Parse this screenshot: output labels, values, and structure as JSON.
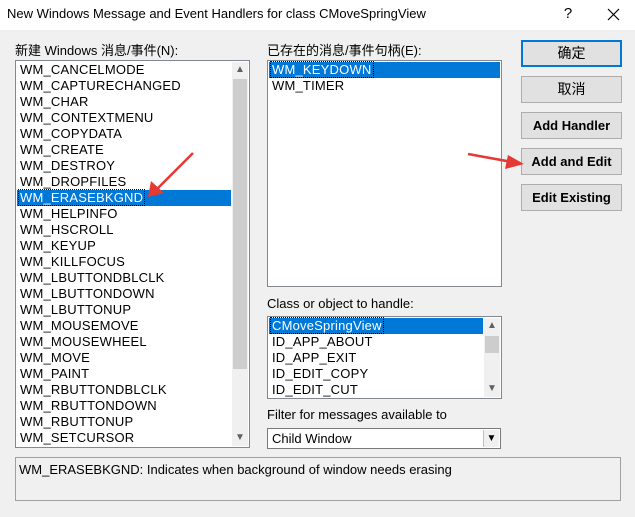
{
  "window": {
    "title": "New Windows Message and Event Handlers for class CMoveSpringView",
    "help_glyph": "?",
    "close_icon": "close-icon"
  },
  "messages_label": "新建 Windows 消息/事件(N):",
  "messages_list": [
    "WM_CANCELMODE",
    "WM_CAPTURECHANGED",
    "WM_CHAR",
    "WM_CONTEXTMENU",
    "WM_COPYDATA",
    "WM_CREATE",
    "WM_DESTROY",
    "WM_DROPFILES",
    "WM_ERASEBKGND",
    "WM_HELPINFO",
    "WM_HSCROLL",
    "WM_KEYUP",
    "WM_KILLFOCUS",
    "WM_LBUTTONDBLCLK",
    "WM_LBUTTONDOWN",
    "WM_LBUTTONUP",
    "WM_MOUSEMOVE",
    "WM_MOUSEWHEEL",
    "WM_MOVE",
    "WM_PAINT",
    "WM_RBUTTONDBLCLK",
    "WM_RBUTTONDOWN",
    "WM_RBUTTONUP",
    "WM_SETCURSOR"
  ],
  "messages_selected": "WM_ERASEBKGND",
  "existing_label": "已存在的消息/事件句柄(E):",
  "existing_list": [
    "WM_KEYDOWN",
    "WM_TIMER"
  ],
  "existing_selected": "WM_KEYDOWN",
  "class_label": "Class or object to handle:",
  "class_list": [
    "CMoveSpringView",
    "ID_APP_ABOUT",
    "ID_APP_EXIT",
    "ID_EDIT_COPY",
    "ID_EDIT_CUT"
  ],
  "class_selected": "CMoveSpringView",
  "filter_label": "Filter for messages available to",
  "filter_value": "Child Window",
  "buttons": {
    "ok": "确定",
    "cancel": "取消",
    "add_handler": "Add Handler",
    "add_and_edit": "Add and Edit",
    "edit_existing": "Edit Existing"
  },
  "description": "WM_ERASEBKGND:  Indicates when background of window needs erasing",
  "colors": {
    "selection": "#0078d7",
    "annotation_arrow": "#e53935"
  }
}
